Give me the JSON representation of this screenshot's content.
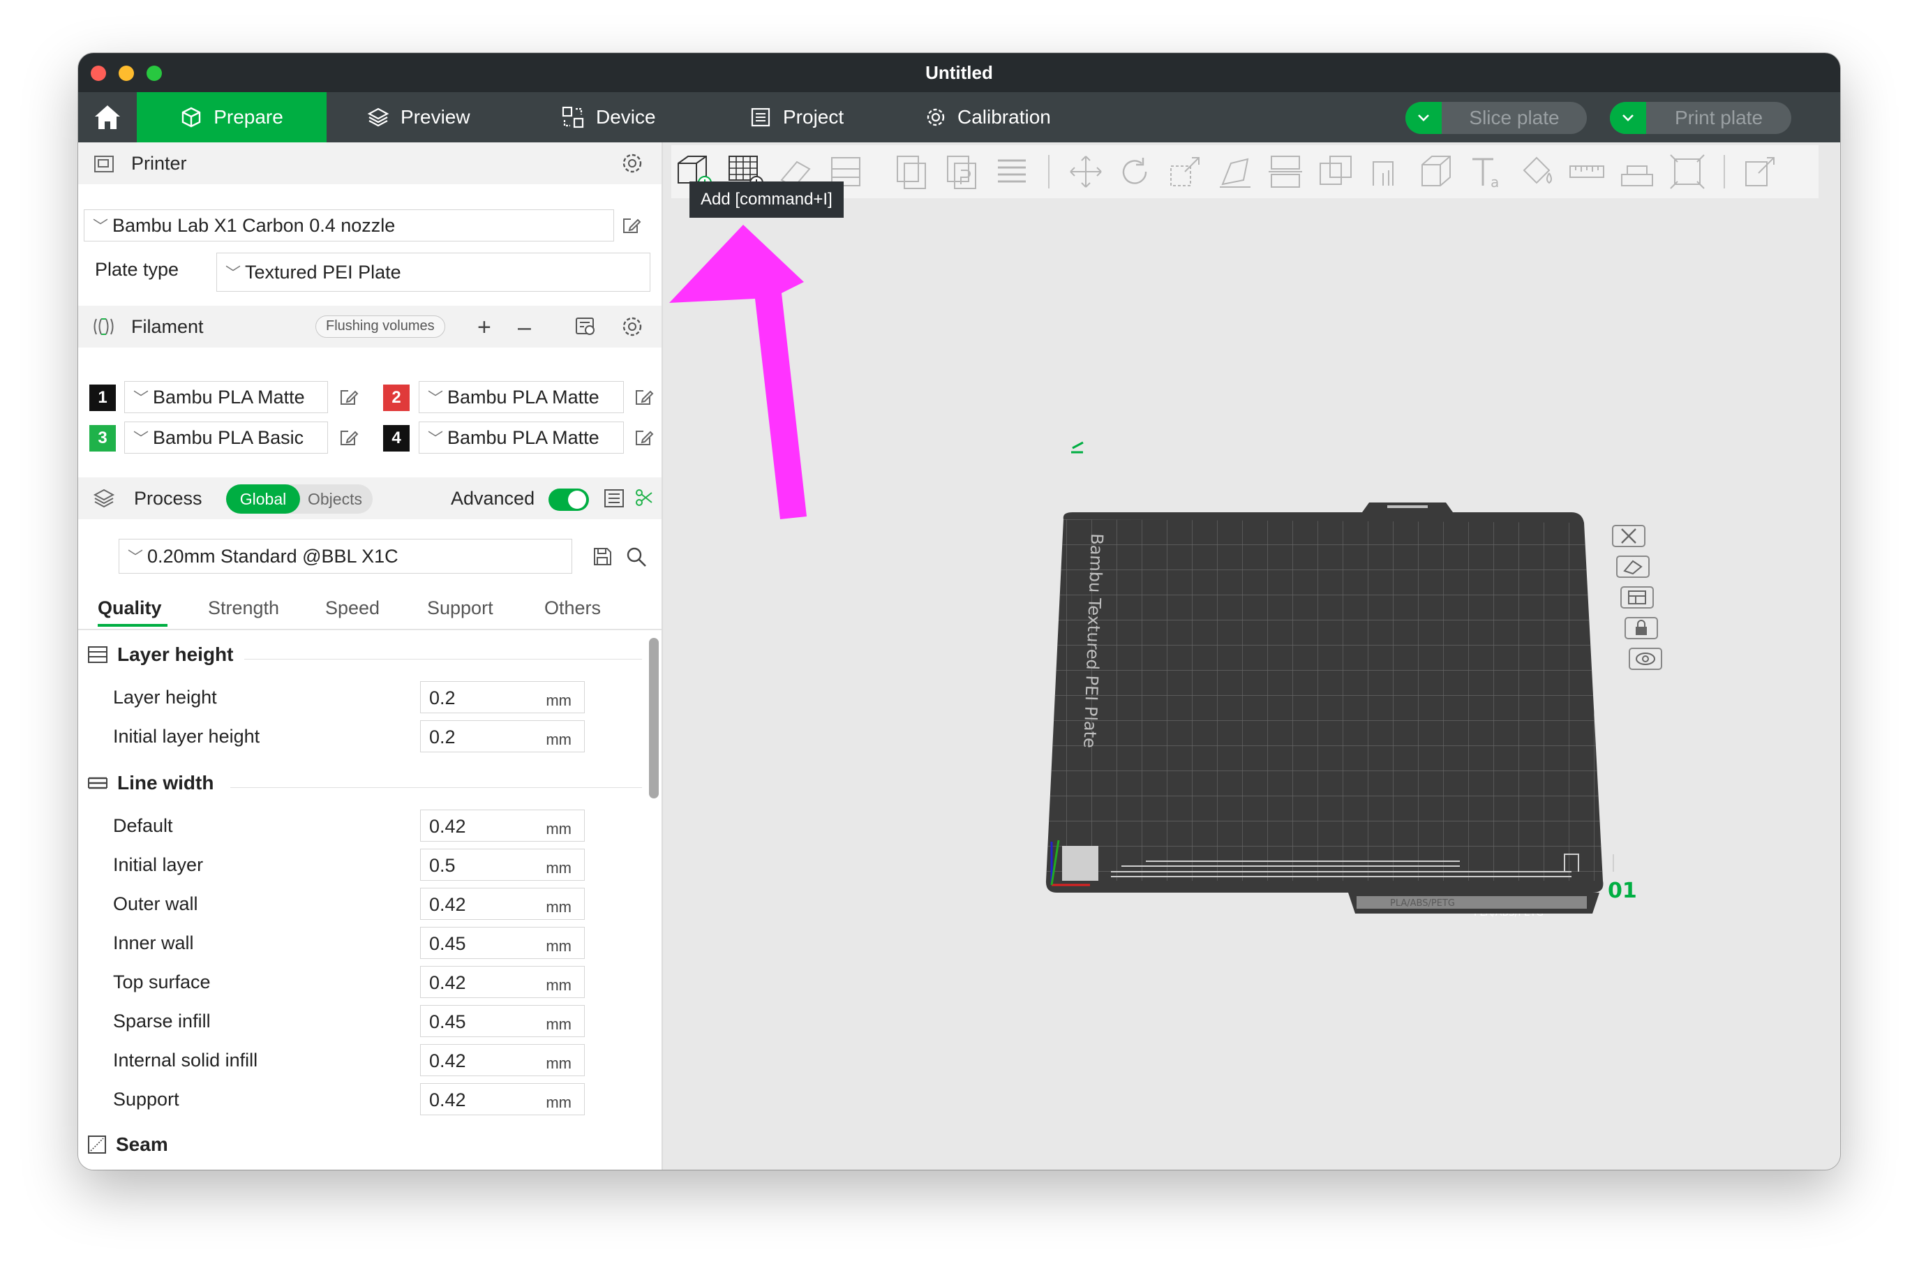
{
  "window": {
    "title": "Untitled"
  },
  "nav": {
    "tabs": [
      {
        "label": "Prepare",
        "active": true
      },
      {
        "label": "Preview"
      },
      {
        "label": "Device"
      },
      {
        "label": "Project"
      },
      {
        "label": "Calibration"
      }
    ],
    "slice_label": "Slice plate",
    "print_label": "Print plate"
  },
  "printer": {
    "section_title": "Printer",
    "preset": "Bambu Lab X1 Carbon 0.4 nozzle",
    "plate_type_label": "Plate type",
    "plate_type": "Textured PEI Plate"
  },
  "filament": {
    "section_title": "Filament",
    "flushing_label": "Flushing volumes",
    "slots": [
      {
        "num": "1",
        "color": "#111111",
        "name": "Bambu PLA Matte"
      },
      {
        "num": "2",
        "color": "#e03a3a",
        "name": "Bambu PLA Matte"
      },
      {
        "num": "3",
        "color": "#1fb24a",
        "name": "Bambu PLA Basic"
      },
      {
        "num": "4",
        "color": "#111111",
        "name": "Bambu PLA Matte"
      }
    ]
  },
  "process": {
    "section_title": "Process",
    "global_label": "Global",
    "objects_label": "Objects",
    "advanced_label": "Advanced",
    "preset": "0.20mm Standard @BBL X1C",
    "tabs": [
      "Quality",
      "Strength",
      "Speed",
      "Support",
      "Others"
    ],
    "active_tab": "Quality"
  },
  "quality": {
    "layer_height_group": "Layer height",
    "layer_height": [
      {
        "label": "Layer height",
        "value": "0.2",
        "unit": "mm"
      },
      {
        "label": "Initial layer height",
        "value": "0.2",
        "unit": "mm"
      }
    ],
    "line_width_group": "Line width",
    "line_width": [
      {
        "label": "Default",
        "value": "0.42",
        "unit": "mm"
      },
      {
        "label": "Initial layer",
        "value": "0.5",
        "unit": "mm"
      },
      {
        "label": "Outer wall",
        "value": "0.42",
        "unit": "mm"
      },
      {
        "label": "Inner wall",
        "value": "0.45",
        "unit": "mm"
      },
      {
        "label": "Top surface",
        "value": "0.42",
        "unit": "mm"
      },
      {
        "label": "Sparse infill",
        "value": "0.45",
        "unit": "mm"
      },
      {
        "label": "Internal solid infill",
        "value": "0.42",
        "unit": "mm"
      },
      {
        "label": "Support",
        "value": "0.42",
        "unit": "mm"
      }
    ],
    "seam_group": "Seam"
  },
  "canvas": {
    "tooltip": "Add [command+I]",
    "plate_label": "Bambu Textured PEI Plate",
    "plate_number": "01",
    "plate_footer": "PLA/ABS/PETG",
    "colors": {
      "accent": "#00ae42",
      "arrow": "#ff33ff",
      "plate": "#3a3a3a"
    }
  }
}
